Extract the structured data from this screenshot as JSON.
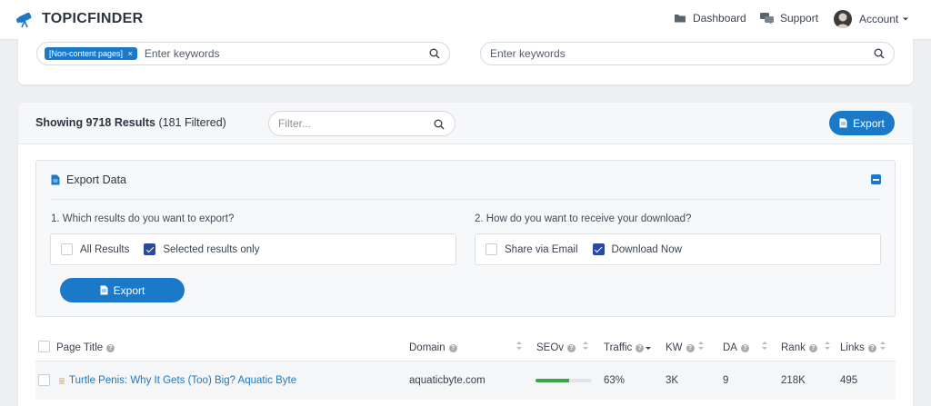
{
  "app": {
    "name": "TOPICFINDER",
    "brand_color": "#1b79c8"
  },
  "nav": {
    "dashboard": "Dashboard",
    "support": "Support",
    "account": "Account"
  },
  "search": {
    "left_tag": "[Non-content pages]",
    "left_tag_remove": "×",
    "left_placeholder": "Enter keywords",
    "right_placeholder": "Enter keywords"
  },
  "results": {
    "showing_label": "Showing 9718 Results",
    "filtered_label": "(181 Filtered)",
    "filter_placeholder": "Filter...",
    "export_button": "Export"
  },
  "export_panel": {
    "title": "Export Data",
    "question1": "1. Which results do you want to export?",
    "question2": "2. How do you want to receive your download?",
    "scope_options": [
      {
        "label": "All Results",
        "checked": false
      },
      {
        "label": "Selected results only",
        "checked": true
      }
    ],
    "delivery_options": [
      {
        "label": "Share via Email",
        "checked": false
      },
      {
        "label": "Download Now",
        "checked": true
      }
    ],
    "export_button": "Export"
  },
  "table": {
    "columns": [
      "Page Title",
      "Domain",
      "SEOv",
      "Traffic",
      "KW",
      "DA",
      "Rank",
      "Links"
    ],
    "rows": [
      {
        "title": "Turtle Penis: Why It Gets (Too) Big? Aquatic Byte",
        "domain": "aquaticbyte.com",
        "seov": 0.6,
        "traffic": "63%",
        "kw": "3K",
        "da": "9",
        "rank": "218K",
        "links": "495"
      }
    ]
  }
}
